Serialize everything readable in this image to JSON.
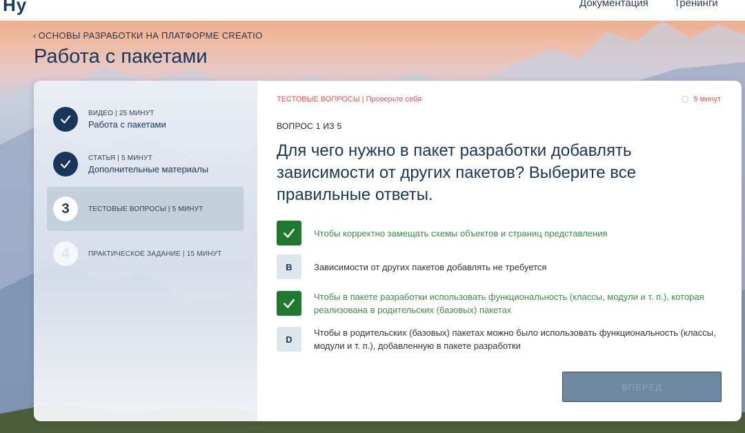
{
  "header": {
    "logo": "Ну",
    "nav": [
      "Документация",
      "Тренинги"
    ]
  },
  "breadcrumb": {
    "label": "ОСНОВЫ РАЗРАБОТКИ НА ПЛАТФОРМЕ CREATIO"
  },
  "page_title": "Работа с пакетами",
  "steps": [
    {
      "number": "✓",
      "meta": "ВИДЕО | 25 МИНУТ",
      "name": "Работа с пакетами",
      "state": "done"
    },
    {
      "number": "✓",
      "meta": "СТАТЬЯ | 5 МИНУТ",
      "name": "Дополнительные материалы",
      "state": "done"
    },
    {
      "number": "3",
      "meta": "ТЕСТОВЫЕ ВОПРОСЫ | 5 МИНУТ",
      "name": "",
      "state": "current"
    },
    {
      "number": "4",
      "meta": "ПРАКТИЧЕСКОЕ ЗАДАНИЕ | 15 МИНУТ",
      "name": "",
      "state": "pending"
    }
  ],
  "quiz": {
    "section": "ТЕСТОВЫЕ ВОПРОСЫ | Проверьте себя",
    "time": "5 минут",
    "counter": "ВОПРОС 1 ИЗ 5",
    "question": "Для чего нужно в пакет разработки добавлять зависимости от других пакетов? Выберите все правильные ответы.",
    "answers": [
      {
        "letter": "",
        "text": "Чтобы корректно замещать схемы объектов и страниц представления",
        "checked": true
      },
      {
        "letter": "B",
        "text": "Зависимости от других пакетов добавлять не требуется",
        "checked": false
      },
      {
        "letter": "",
        "text": "Чтобы в пакете разработки использовать функциональность (классы, модули и т. п.), которая реализована в родительских (базовых) пакетах",
        "checked": true
      },
      {
        "letter": "D",
        "text": "Чтобы в родительских (базовых) пакетах можно было использовать функциональность (классы, модули и т. п.), добавленную в пакете разработки",
        "checked": false
      }
    ],
    "next_label": "ВПЕРЕД"
  },
  "colors": {
    "accent": "#17365a",
    "correct": "#1f7a2f",
    "highlight": "#e0524f",
    "button": "#6e88a2"
  }
}
